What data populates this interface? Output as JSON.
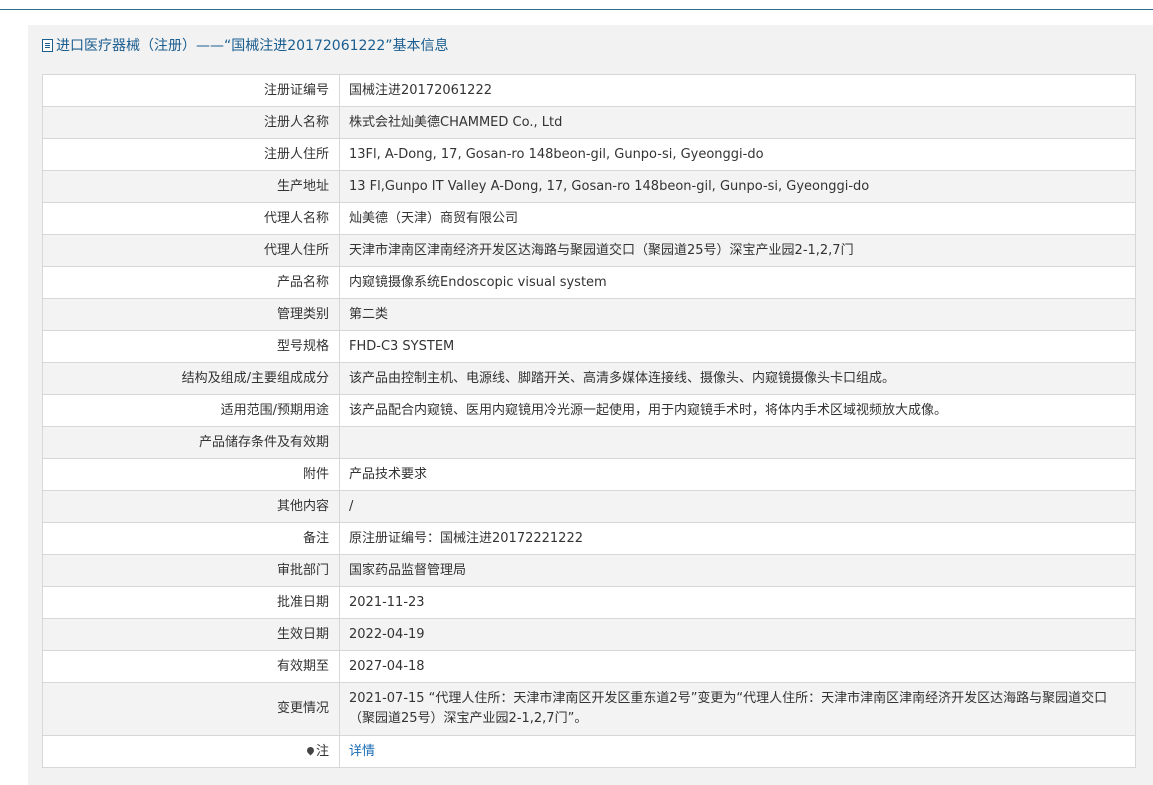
{
  "header": {
    "title": "进口医疗器械（注册）——“国械注进20172061222”基本信息",
    "icon": "document-icon"
  },
  "rows": [
    {
      "label": "注册证编号",
      "value": "国械注进20172061222"
    },
    {
      "label": "注册人名称",
      "value": "株式会社灿美德CHAMMED Co., Ltd"
    },
    {
      "label": "注册人住所",
      "value": "13Fl, A-Dong, 17, Gosan-ro 148beon-gil, Gunpo-si, Gyeonggi-do"
    },
    {
      "label": "生产地址",
      "value": "13 Fl,Gunpo IT Valley A-Dong, 17, Gosan-ro 148beon-gil, Gunpo-si, Gyeonggi-do"
    },
    {
      "label": "代理人名称",
      "value": "灿美德（天津）商贸有限公司"
    },
    {
      "label": "代理人住所",
      "value": "天津市津南区津南经济开发区达海路与聚园道交口（聚园道25号）深宝产业园2-1,2,7门"
    },
    {
      "label": "产品名称",
      "value": "内窥镜摄像系统Endoscopic visual system"
    },
    {
      "label": "管理类别",
      "value": "第二类"
    },
    {
      "label": "型号规格",
      "value": "FHD-C3 SYSTEM"
    },
    {
      "label": "结构及组成/主要组成成分",
      "value": "该产品由控制主机、电源线、脚踏开关、高清多媒体连接线、摄像头、内窥镜摄像头卡口组成。"
    },
    {
      "label": "适用范围/预期用途",
      "value": "该产品配合内窥镜、医用内窥镜用冷光源一起使用，用于内窥镜手术时，将体内手术区域视频放大成像。"
    },
    {
      "label": "产品储存条件及有效期",
      "value": ""
    },
    {
      "label": "附件",
      "value": "产品技术要求"
    },
    {
      "label": "其他内容",
      "value": "/"
    },
    {
      "label": "备注",
      "value": "原注册证编号：国械注进20172221222"
    },
    {
      "label": "审批部门",
      "value": "国家药品监督管理局"
    },
    {
      "label": "批准日期",
      "value": "2021-11-23"
    },
    {
      "label": "生效日期",
      "value": "2022-04-19"
    },
    {
      "label": "有效期至",
      "value": "2027-04-18"
    },
    {
      "label": "变更情况",
      "value": "2021-07-15 “代理人住所：天津市津南区开发区重东道2号”变更为“代理人住所：天津市津南区津南经济开发区达海路与聚园道交口（聚园道25号）深宝产业园2-1,2,7门”。"
    }
  ],
  "note": {
    "label": "注",
    "icon": "pin-icon",
    "link": "详情"
  }
}
